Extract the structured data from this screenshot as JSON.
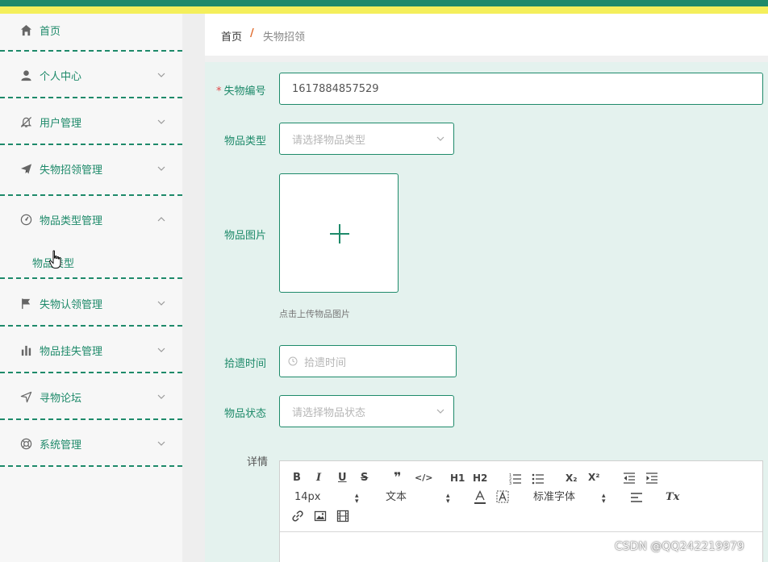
{
  "colors": {
    "brand": "#1e8a6a",
    "accent_yellow": "#f4ef5b",
    "required": "#e04848",
    "separator": "#e06a2b"
  },
  "sidebar": {
    "items": [
      {
        "label": "首页",
        "icon": "home-icon"
      },
      {
        "label": "个人中心",
        "icon": "user-icon"
      },
      {
        "label": "用户管理",
        "icon": "bell-off-icon"
      },
      {
        "label": "失物招领管理",
        "icon": "paper-plane-icon"
      },
      {
        "label": "物品类型管理",
        "icon": "dashboard-icon",
        "expanded": true,
        "children": [
          {
            "label": "物品类型"
          }
        ]
      },
      {
        "label": "失物认领管理",
        "icon": "flag-icon"
      },
      {
        "label": "物品挂失管理",
        "icon": "bar-chart-icon"
      },
      {
        "label": "寻物论坛",
        "icon": "location-arrow-icon"
      },
      {
        "label": "系统管理",
        "icon": "lifebuoy-icon"
      }
    ]
  },
  "breadcrumb": {
    "home": "首页",
    "separator": "/",
    "current": "失物招领"
  },
  "form": {
    "lost_id": {
      "label": "失物编号",
      "value": "1617884857529",
      "required": true
    },
    "item_type": {
      "label": "物品类型",
      "placeholder": "请选择物品类型"
    },
    "item_image": {
      "label": "物品图片",
      "tip": "点击上传物品图片"
    },
    "pickup_time": {
      "label": "拾遗时间",
      "placeholder": "拾遗时间"
    },
    "item_status": {
      "label": "物品状态",
      "placeholder": "请选择物品状态"
    },
    "details": {
      "label": "详情",
      "toolbar": {
        "bold": "B",
        "italic": "I",
        "underline": "U",
        "strike": "S",
        "quote": "❞",
        "code": "</>",
        "h1": "H1",
        "h2": "H2",
        "subscript": "X₂",
        "superscript": "X²",
        "font_size": "14px",
        "header_type": "文本",
        "font_family": "标准字体",
        "clear_format": "Tx"
      }
    }
  },
  "watermark": "CSDN @QQ242219979"
}
